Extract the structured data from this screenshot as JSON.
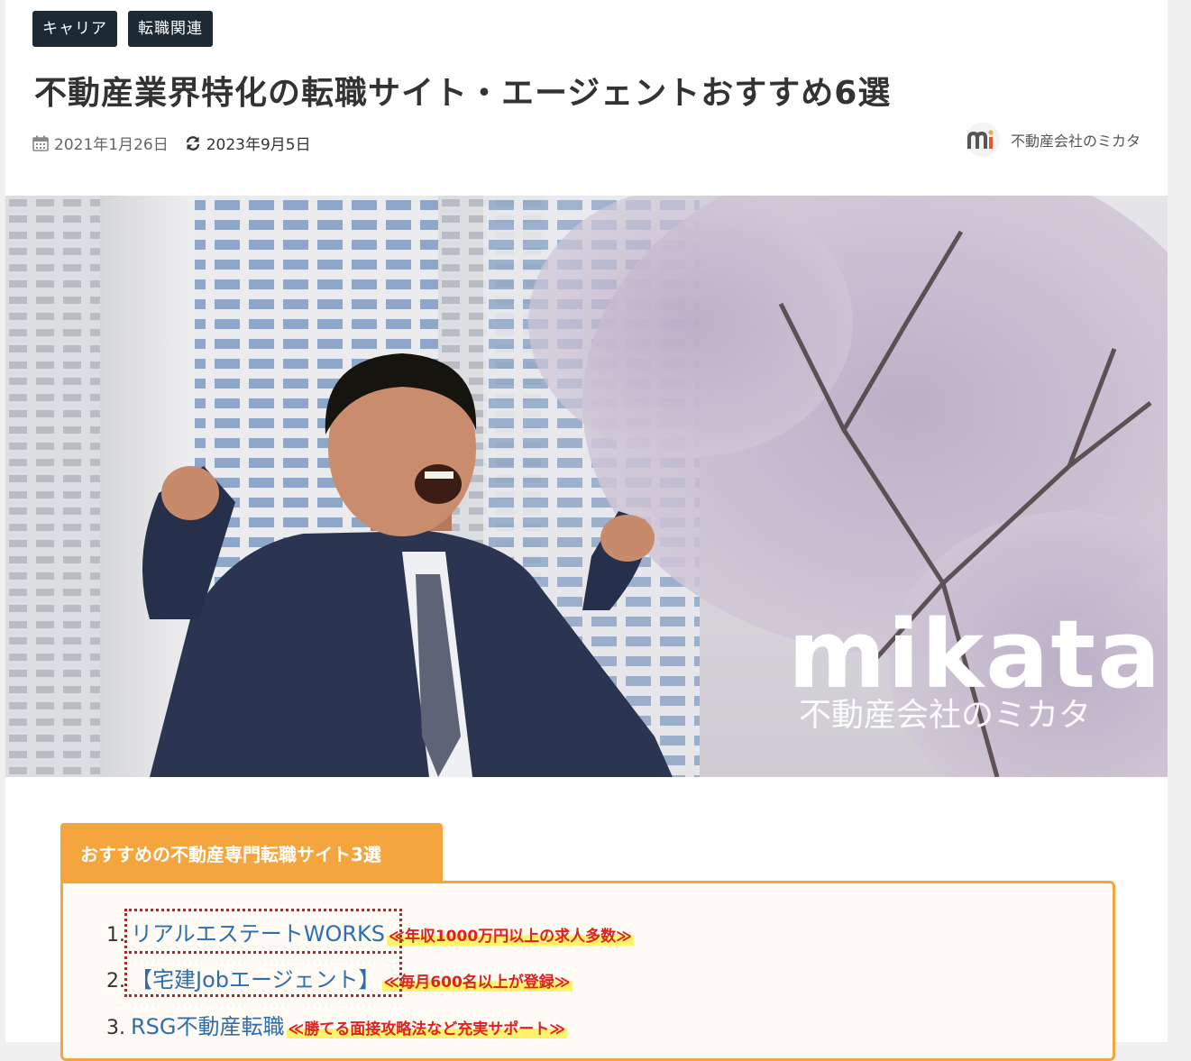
{
  "tags": [
    "キャリア",
    "転職関連"
  ],
  "article": {
    "title": "不動産業界特化の転職サイト・エージェントおすすめ6選",
    "published": "2021年1月26日",
    "updated": "2023年9月5日",
    "author": "不動産会社のミカタ"
  },
  "hero": {
    "logo_text": "mikata",
    "logo_subtext": "不動産会社のミカタ"
  },
  "toc": {
    "heading": "おすすめの不動産専門転職サイト3選",
    "items": [
      {
        "num": "1.",
        "label": "リアルエステートWORKS",
        "note": "≪年収1000万円以上の求人多数≫"
      },
      {
        "num": "2.",
        "label": "【宅建Jobエージェント】",
        "note": "≪毎月600名以上が登録≫"
      },
      {
        "num": "3.",
        "label": "RSG不動産転職",
        "note": "≪勝てる面接攻略法など充実サポート≫"
      }
    ]
  },
  "colors": {
    "tag_bg": "#1e2a33",
    "accent_orange": "#f5a53e",
    "link_blue": "#2b6fb0",
    "note_red": "#e12020",
    "highlight_yellow": "#fff36a"
  },
  "icons": {
    "published": "calendar-icon",
    "updated": "refresh-icon",
    "author_avatar": "mikata-logo-icon"
  }
}
